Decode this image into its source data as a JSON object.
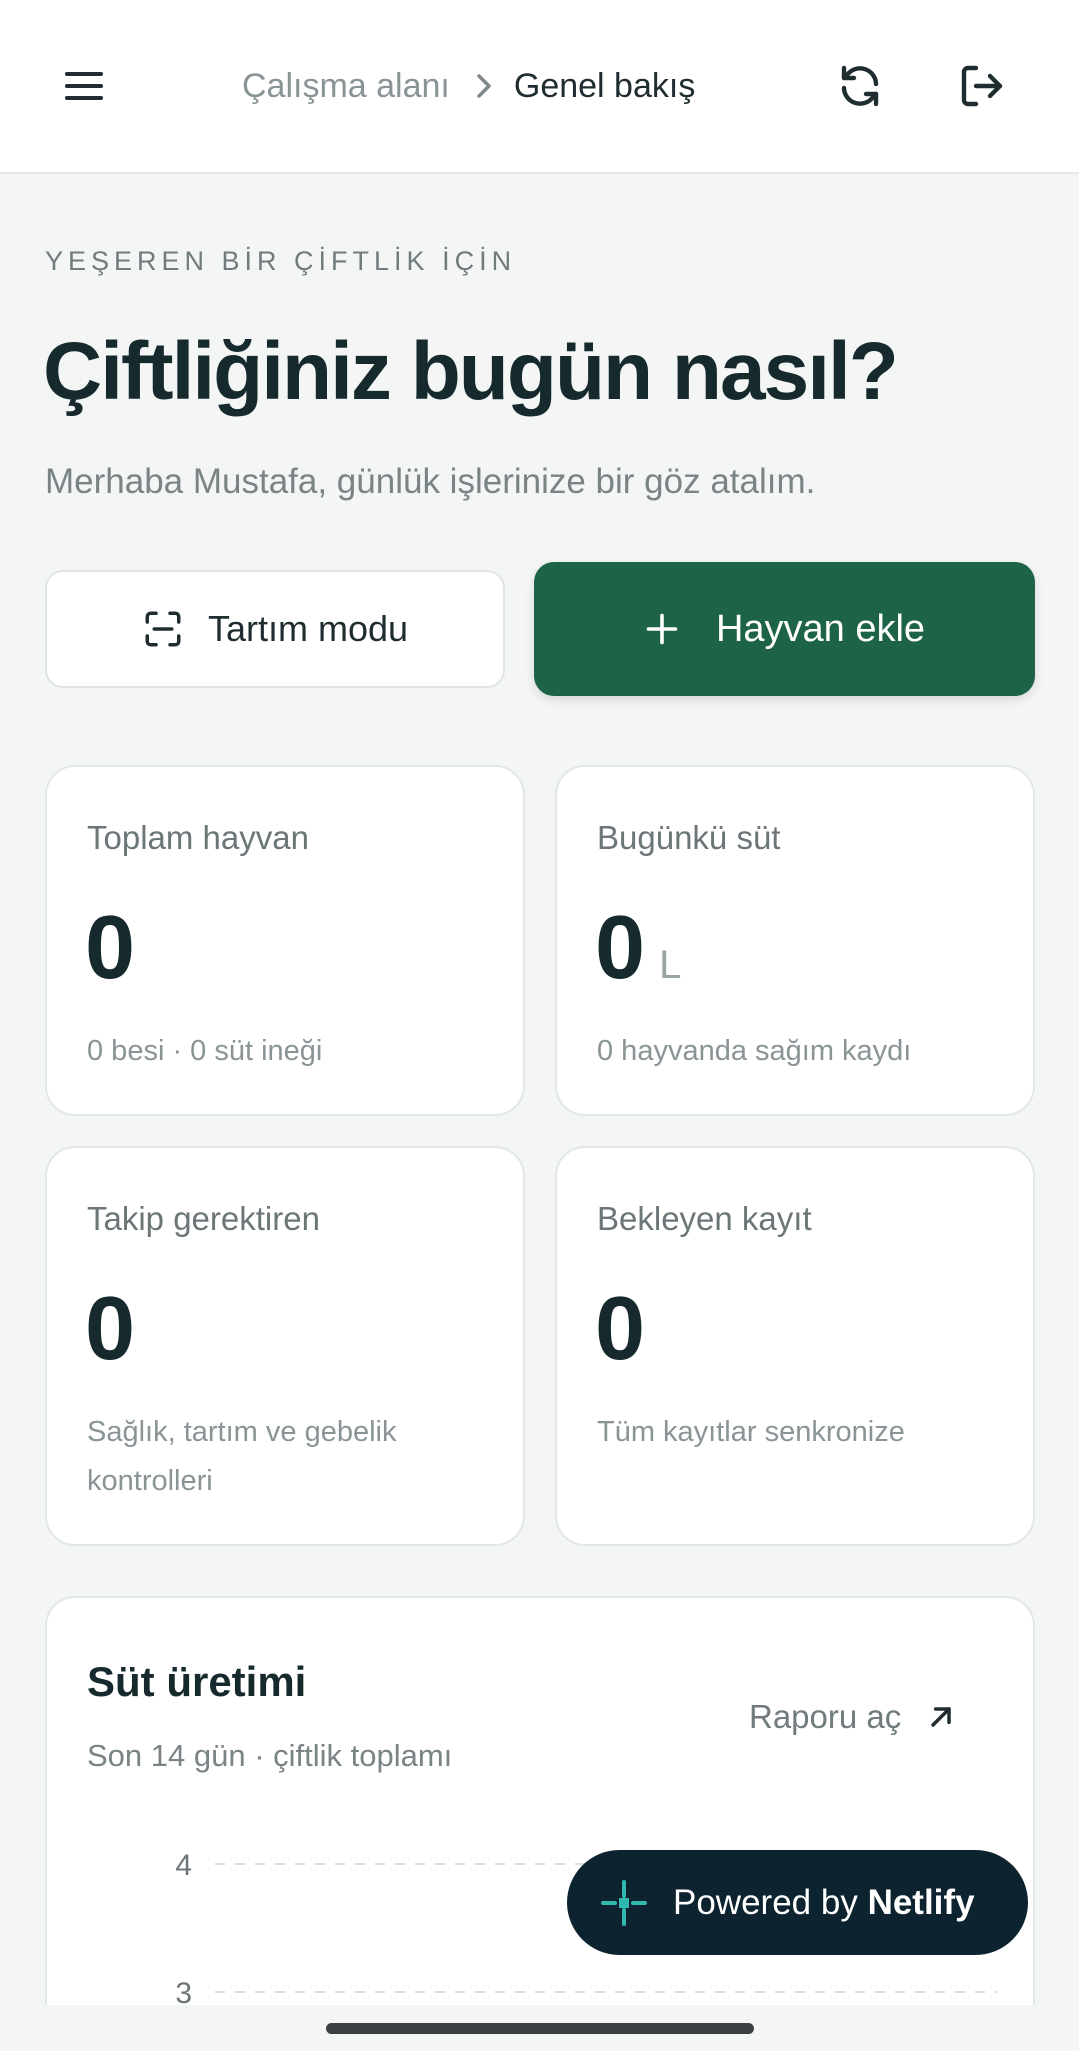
{
  "header": {
    "menu_icon": "hamburger-menu-icon",
    "breadcrumb": [
      "Çalışma alanı",
      "Genel bakış"
    ],
    "sync_icon": "refresh-icon",
    "logout_icon": "logout-icon"
  },
  "hero": {
    "eyebrow": "YEŞEREN BİR ÇİFTLİK İÇİN",
    "title": "Çiftliğiniz bugün nasıl?",
    "subtitle": "Merhaba Mustafa, günlük işlerinize bir göz atalım."
  },
  "actions": {
    "weigh_label": "Tartım modu",
    "add_label": "Hayvan ekle"
  },
  "stats": [
    {
      "label": "Toplam hayvan",
      "value": "0",
      "unit": "",
      "sub": "0 besi · 0 süt ineği"
    },
    {
      "label": "Bugünkü süt",
      "value": "0",
      "unit": "L",
      "sub": "0 hayvanda sağım kaydı"
    },
    {
      "label": "Takip gerektiren",
      "value": "0",
      "unit": "",
      "sub": "Sağlık, tartım ve gebelik kontrolleri"
    },
    {
      "label": "Bekleyen kayıt",
      "value": "0",
      "unit": "",
      "sub": "Tüm kayıtlar senkronize"
    }
  ],
  "milk_card": {
    "title": "Süt üretimi",
    "subtitle": "Son 14 gün · çiftlik toplamı",
    "report_label": "Raporu aç"
  },
  "chart_data": {
    "type": "line",
    "title": "Süt üretimi",
    "y_ticks": [
      4,
      3
    ],
    "grid": true,
    "series": []
  },
  "badge": {
    "prefix": "Powered by",
    "brand": "Netlify"
  },
  "colors": {
    "primary": "#1d6446",
    "badge_bg": "#0e2330",
    "badge_accent": "#32b9b0"
  }
}
